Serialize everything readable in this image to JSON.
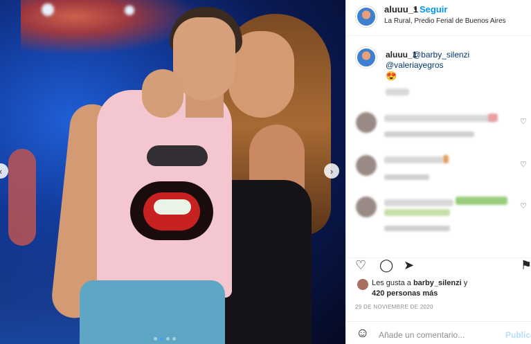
{
  "post": {
    "username": "aluuu_1",
    "separator": "•",
    "follow_label": "Seguir",
    "location": "La Rural, Predio Ferial de Buenos Aires"
  },
  "caption": {
    "username": "aluuu_1",
    "mention1": "@barby_silenzi",
    "mention2": "@valeriayegros",
    "emoji": "😍"
  },
  "comments": {
    "heart_icon": "♡"
  },
  "actions": {
    "like_icon": "♡",
    "comment_icon": "◯",
    "share_icon": "➤",
    "save_icon": "⚑"
  },
  "likes": {
    "prefix": "Les gusta a",
    "user": "barby_silenzi",
    "suffix": "y",
    "others": "420 personas más"
  },
  "date": "29 DE NOVIEMBRE DE 2020",
  "add_comment": {
    "placeholder": "Añade un comentario...",
    "publish_label": "Publica",
    "emoji_icon": "☺"
  },
  "carousel": {
    "prev_icon": "‹",
    "next_icon": "›",
    "slides": 4,
    "active": 2
  }
}
